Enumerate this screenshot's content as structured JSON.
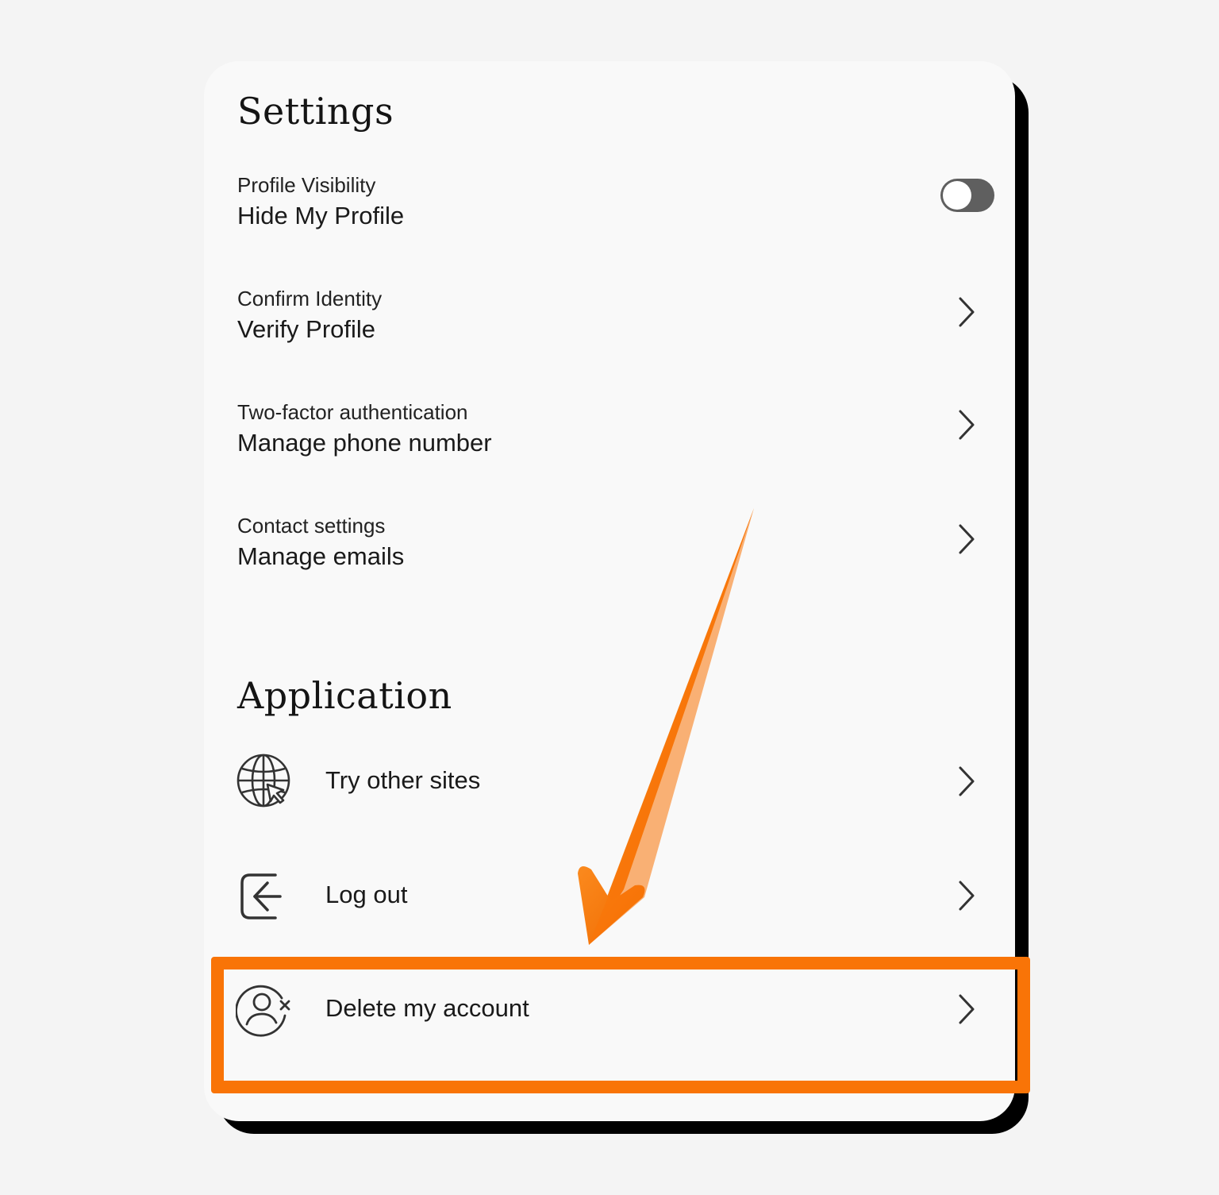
{
  "settings": {
    "title": "Settings",
    "rows": [
      {
        "label": "Profile Visibility",
        "value": "Hide My Profile",
        "control": "toggle",
        "toggle_on": false
      },
      {
        "label": "Confirm Identity",
        "value": "Verify Profile",
        "control": "chevron"
      },
      {
        "label": "Two-factor authentication",
        "value": "Manage phone number",
        "control": "chevron"
      },
      {
        "label": "Contact settings",
        "value": "Manage emails",
        "control": "chevron"
      }
    ]
  },
  "application": {
    "title": "Application",
    "items": [
      {
        "label": "Try other sites",
        "icon": "globe-cursor-icon"
      },
      {
        "label": "Log out",
        "icon": "logout-arrow-icon"
      },
      {
        "label": "Delete my account",
        "icon": "user-remove-icon"
      }
    ]
  },
  "annotation": {
    "highlight_color": "#f97407",
    "arrow_color": "#f97407",
    "highlighted_item": "Delete my account"
  },
  "colors": {
    "background": "#f4f4f4",
    "card": "#f9f9f9",
    "toggle_track": "#5f5f5f",
    "text": "#1a1a1a"
  }
}
